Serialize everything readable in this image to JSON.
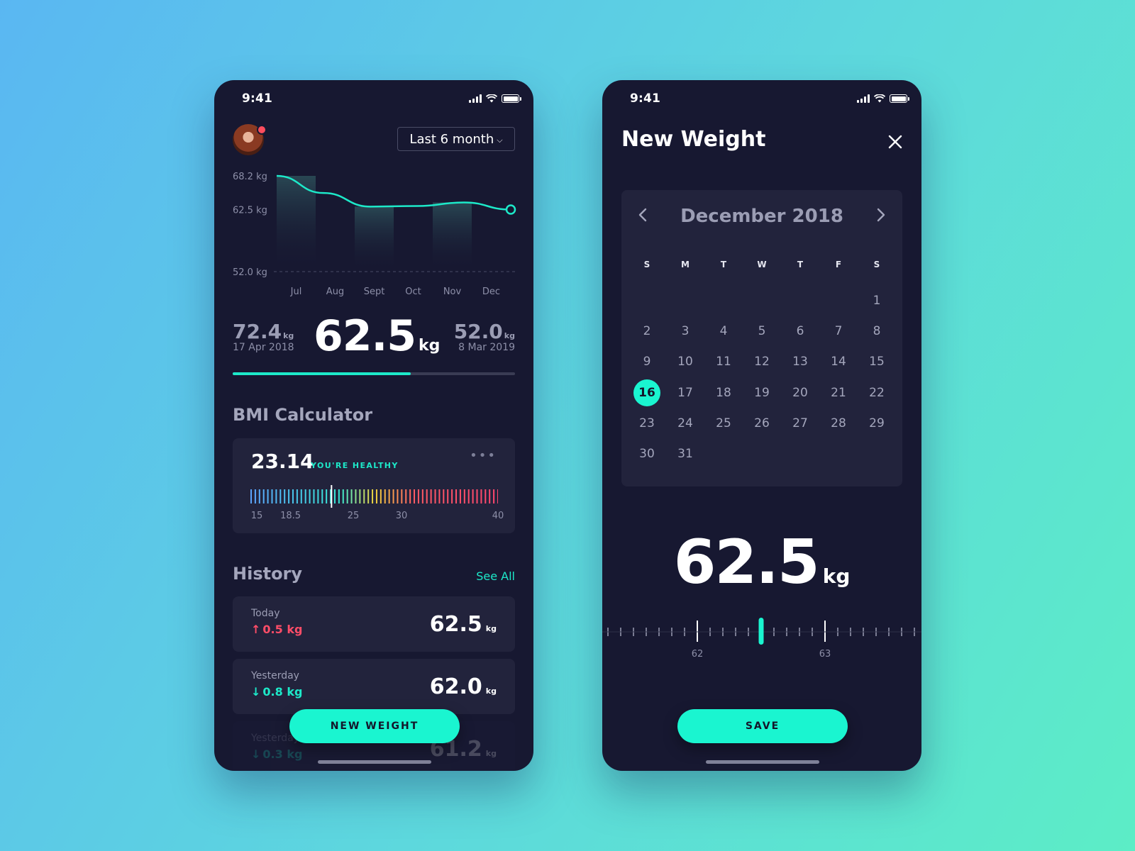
{
  "left_screen": {
    "status_time": "9:41",
    "range_selector": "Last 6 month",
    "chart_data": {
      "type": "area",
      "x": [
        "Jul",
        "Aug",
        "Sept",
        "Oct",
        "Nov",
        "Dec"
      ],
      "series": [
        {
          "values": [
            68.2,
            65.3,
            63.0,
            63.1,
            63.7,
            62.5
          ]
        }
      ],
      "y_tick_labels": [
        "68.2 kg",
        "62.5 kg",
        "52.0 kg"
      ],
      "ylim": [
        52.0,
        68.2
      ],
      "grid": false,
      "accent_color": "#1de9c9"
    },
    "stats": {
      "start_value": "72.4",
      "start_unit": "kg",
      "start_date": "17 Apr 2018",
      "current_value": "62.5",
      "current_unit": "kg",
      "goal_value": "52.0",
      "goal_unit": "kg",
      "goal_date": "8 Mar 2019",
      "progress_fraction": 0.63
    },
    "bmi": {
      "title": "BMI Calculator",
      "value": "23.14",
      "status": "YOU'RE HEALTHY",
      "more_icon": "more-dots-icon",
      "marker_value": 23.14,
      "scale_min": 15,
      "scale_max": 40,
      "tick_labels": [
        "15",
        "18.5",
        "25",
        "30",
        "40"
      ]
    },
    "history": {
      "title": "History",
      "see_all": "See All",
      "items": [
        {
          "label": "Today",
          "delta": "0.5 kg",
          "direction": "up",
          "value": "62.5",
          "unit": "kg"
        },
        {
          "label": "Yesterday",
          "delta": "0.8 kg",
          "direction": "down",
          "value": "62.0",
          "unit": "kg"
        },
        {
          "label": "Yesterday",
          "delta": "0.3 kg",
          "direction": "down",
          "value": "61.2",
          "unit": "kg"
        }
      ]
    },
    "new_weight_button": "NEW WEIGHT"
  },
  "right_screen": {
    "status_time": "9:41",
    "title": "New Weight",
    "calendar": {
      "month_label": "December 2018",
      "weekdays": [
        "S",
        "M",
        "T",
        "W",
        "T",
        "F",
        "S"
      ],
      "first_weekday_offset": 6,
      "days_in_month": 31,
      "selected_day": 16
    },
    "weight_value": "62.5",
    "weight_unit": "kg",
    "ruler": {
      "labels": [
        "62",
        "63"
      ],
      "selected_value": 62.5
    },
    "save_button": "SAVE"
  },
  "colors": {
    "accent": "#1af5d0",
    "up": "#ff4d68",
    "card": "#22233c",
    "phone_bg": "#171831"
  }
}
